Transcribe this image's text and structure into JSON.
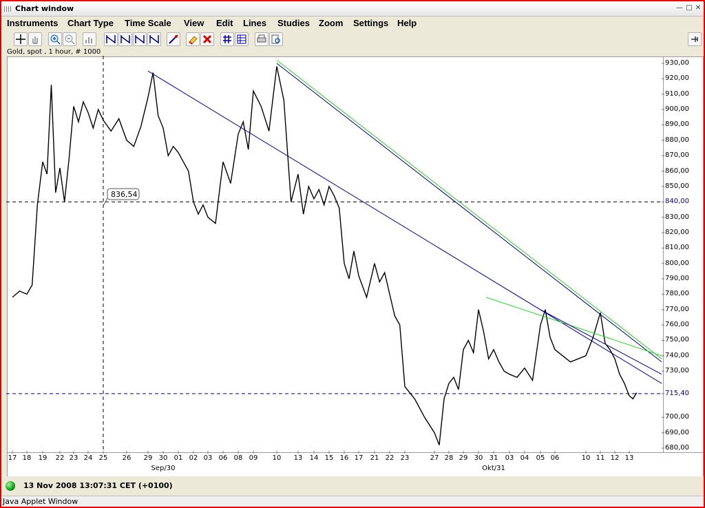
{
  "window": {
    "title": "Chart window"
  },
  "menu": [
    "Instruments",
    "Chart Type",
    "Time Scale",
    "View",
    "Edit",
    "Lines",
    "Studies",
    "Zoom",
    "Settings",
    "Help"
  ],
  "toolbar": {
    "tools": [
      "crosshair-icon",
      "hand-icon",
      "zoom-in-icon",
      "zoom-out-icon",
      "bar-chart-icon",
      "line-study-1-icon",
      "line-study-2-icon",
      "line-study-3-icon",
      "line-study-4-icon",
      "line-draw-icon",
      "eraser-icon",
      "delete-icon",
      "grid-icon",
      "table-icon",
      "print-icon",
      "print-preview-icon",
      "pin-icon"
    ]
  },
  "chart_caption": "Gold, spot , 1 hour, # 1000",
  "chart_data": {
    "type": "line",
    "instrument": "Gold, spot",
    "timeframe": "1 hour",
    "y_ticks": [
      "930,00",
      "920,00",
      "910,00",
      "900,00",
      "890,00",
      "880,00",
      "870,00",
      "860,00",
      "850,00",
      "840,00",
      "830,00",
      "820,00",
      "810,00",
      "800,00",
      "790,00",
      "780,00",
      "770,00",
      "760,00",
      "750,00",
      "740,00",
      "730,00",
      "715,40",
      "700,00",
      "690,00",
      "680,00"
    ],
    "ylim": [
      680,
      930
    ],
    "x_ticks": [
      "17",
      "18",
      "19",
      "22",
      "23",
      "24",
      "25",
      "26",
      "29",
      "30",
      "01",
      "02",
      "03",
      "06",
      "08",
      "09",
      "10",
      "13",
      "14",
      "15",
      "16",
      "17",
      "21",
      "22",
      "23",
      "27",
      "28",
      "29",
      "30",
      "31",
      "03",
      "04",
      "05",
      "06",
      "10",
      "11",
      "12",
      "13"
    ],
    "x_month_labels": [
      "Sep/30",
      "Okt/31"
    ],
    "crosshair": {
      "price_label": "836,54",
      "price": 836.54,
      "x_label": "25"
    },
    "reference_lines": [
      {
        "price": 840.0,
        "style": "dashed",
        "color": "#000000"
      },
      {
        "price": 715.4,
        "style": "dashed",
        "color": "#000080"
      }
    ],
    "price_series": [
      [
        "17",
        778
      ],
      [
        "17",
        782
      ],
      [
        "18",
        780
      ],
      [
        "18",
        786
      ],
      [
        "18",
        838
      ],
      [
        "19",
        866
      ],
      [
        "19",
        858
      ],
      [
        "19",
        916
      ],
      [
        "19",
        846
      ],
      [
        "22",
        862
      ],
      [
        "22",
        840
      ],
      [
        "22",
        868
      ],
      [
        "23",
        902
      ],
      [
        "23",
        892
      ],
      [
        "23",
        905
      ],
      [
        "24",
        898
      ],
      [
        "24",
        888
      ],
      [
        "24",
        900
      ],
      [
        "25",
        893
      ],
      [
        "25",
        886
      ],
      [
        "25",
        894
      ],
      [
        "26",
        880
      ],
      [
        "26",
        876
      ],
      [
        "26",
        889
      ],
      [
        "29",
        908
      ],
      [
        "29",
        924
      ],
      [
        "29",
        896
      ],
      [
        "30",
        888
      ],
      [
        "30",
        870
      ],
      [
        "30",
        876
      ],
      [
        "01",
        872
      ],
      [
        "01",
        866
      ],
      [
        "01",
        860
      ],
      [
        "02",
        840
      ],
      [
        "02",
        832
      ],
      [
        "02",
        838
      ],
      [
        "03",
        830
      ],
      [
        "03",
        826
      ],
      [
        "06",
        866
      ],
      [
        "06",
        852
      ],
      [
        "08",
        884
      ],
      [
        "08",
        892
      ],
      [
        "08",
        874
      ],
      [
        "09",
        912
      ],
      [
        "09",
        902
      ],
      [
        "09",
        886
      ],
      [
        "10",
        928
      ],
      [
        "10",
        906
      ],
      [
        "10",
        840
      ],
      [
        "13",
        858
      ],
      [
        "13",
        832
      ],
      [
        "13",
        850
      ],
      [
        "14",
        842
      ],
      [
        "14",
        848
      ],
      [
        "14",
        838
      ],
      [
        "15",
        850
      ],
      [
        "15",
        844
      ],
      [
        "15",
        836
      ],
      [
        "16",
        800
      ],
      [
        "16",
        790
      ],
      [
        "16",
        808
      ],
      [
        "17",
        792
      ],
      [
        "17",
        778
      ],
      [
        "21",
        800
      ],
      [
        "21",
        788
      ],
      [
        "21",
        794
      ],
      [
        "22",
        780
      ],
      [
        "22",
        766
      ],
      [
        "22",
        760
      ],
      [
        "23",
        720
      ],
      [
        "23",
        712
      ],
      [
        "23",
        700
      ],
      [
        "27",
        690
      ],
      [
        "27",
        682
      ],
      [
        "27",
        712
      ],
      [
        "28",
        722
      ],
      [
        "28",
        726
      ],
      [
        "28",
        718
      ],
      [
        "29",
        744
      ],
      [
        "29",
        750
      ],
      [
        "29",
        742
      ],
      [
        "30",
        770
      ],
      [
        "30",
        756
      ],
      [
        "30",
        738
      ],
      [
        "31",
        744
      ],
      [
        "31",
        736
      ],
      [
        "31",
        730
      ],
      [
        "03",
        728
      ],
      [
        "03",
        726
      ],
      [
        "04",
        732
      ],
      [
        "04",
        724
      ],
      [
        "05",
        760
      ],
      [
        "05",
        770
      ],
      [
        "05",
        752
      ],
      [
        "06",
        744
      ],
      [
        "06",
        736
      ],
      [
        "10",
        740
      ],
      [
        "10",
        752
      ],
      [
        "11",
        768
      ],
      [
        "11",
        748
      ],
      [
        "11",
        744
      ],
      [
        "12",
        738
      ],
      [
        "12",
        728
      ],
      [
        "12",
        722
      ],
      [
        "13",
        714
      ],
      [
        "13",
        712
      ],
      [
        "13",
        716
      ]
    ],
    "trend_lines": [
      {
        "color": "#00008b",
        "from": [
          "29",
          925
        ],
        "to": [
          "13",
          722
        ]
      },
      {
        "color": "#00008b",
        "from": [
          "10",
          930
        ],
        "to": [
          "13",
          736
        ]
      },
      {
        "color": "#2ecc2e",
        "from": [
          "10",
          932
        ],
        "to": [
          "13",
          738
        ]
      },
      {
        "color": "#2ecc2e",
        "from": [
          "30",
          778
        ],
        "to": [
          "13",
          740
        ]
      },
      {
        "color": "#00008b",
        "from": [
          "05",
          770
        ],
        "to": [
          "13",
          728
        ]
      }
    ],
    "grid": false
  },
  "status": {
    "datetime": "13 Nov 2008 13:07:31 CET (+0100)"
  },
  "applet": {
    "label": "Java Applet Window"
  }
}
